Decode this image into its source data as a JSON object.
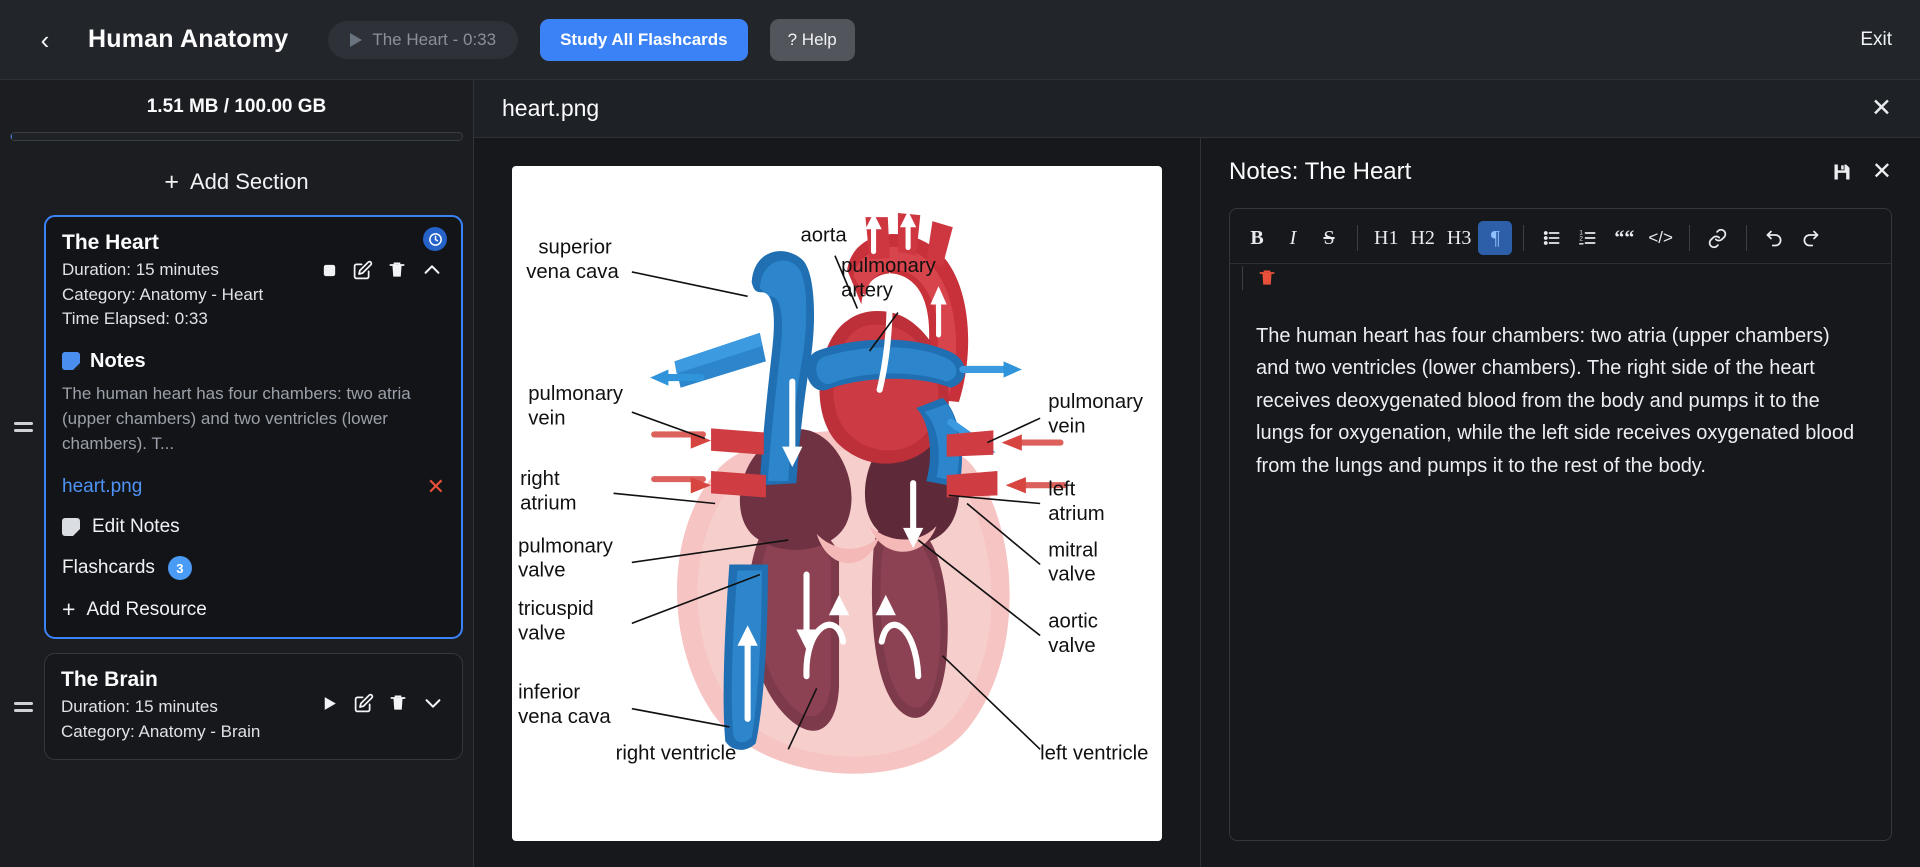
{
  "topbar": {
    "back_icon": "chevron-left-icon",
    "app_title": "Human Anatomy",
    "timer_label": "The Heart - 0:33",
    "study_all_label": "Study All Flashcards",
    "help_label": "? Help",
    "exit_label": "Exit",
    "accent": "#3b82f6"
  },
  "sidebar": {
    "storage_label": "1.51 MB / 100.00 GB",
    "add_section_label": "Add Section",
    "sections": [
      {
        "title": "The Heart",
        "duration": "Duration: 15 minutes",
        "category": "Category: Anatomy - Heart",
        "time_elapsed": "Time Elapsed: 0:33",
        "active": true,
        "notes_heading": "Notes",
        "notes_excerpt": "The human heart has four chambers: two atria (upper chambers) and two ventricles (lower chambers). T...",
        "resource_name": "heart.png",
        "edit_notes_label": "Edit Notes",
        "flashcards_label": "Flashcards",
        "flashcards_count": "3",
        "add_resource_label": "Add Resource"
      },
      {
        "title": "The Brain",
        "duration": "Duration: 15 minutes",
        "category": "Category: Anatomy - Brain",
        "active": false
      }
    ]
  },
  "main": {
    "file_name": "heart.png",
    "close_icon": "close-icon"
  },
  "notes_panel": {
    "title": "Notes: The Heart",
    "save_icon": "save-icon",
    "close_icon": "close-icon",
    "toolbar": {
      "bold": "B",
      "italic": "I",
      "strike": "S",
      "h1": "H1",
      "h2": "H2",
      "h3": "H3",
      "paragraph": "¶",
      "bullet_list": "bullet-list-icon",
      "numbered_list": "numbered-list-icon",
      "blockquote": "quote-icon",
      "code_block": "code-icon",
      "link": "link-icon",
      "undo": "undo-icon",
      "redo": "redo-icon",
      "delete": "trash-icon"
    },
    "content": "The human heart has four chambers: two atria (upper chambers) and two ventricles (lower chambers). The right side of the heart receives deoxygenated blood from the body and pumps it to the lungs for oxygenation, while the left side receives oxygenated blood from the lungs and pumps it to the rest of the body."
  },
  "diagram": {
    "labels": {
      "superior_vena_cava": "superior\nvena cava",
      "superior_vena_cava_l1": "superior",
      "superior_vena_cava_l2": "vena cava",
      "aorta": "aorta",
      "pulmonary_artery_l1": "pulmonary",
      "pulmonary_artery_l2": "artery",
      "pulmonary_vein_left_l1": "pulmonary",
      "pulmonary_vein_left_l2": "vein",
      "pulmonary_vein_right_l1": "pulmonary",
      "pulmonary_vein_right_l2": "vein",
      "right_atrium_l1": "right",
      "right_atrium_l2": "atrium",
      "left_atrium_l1": "left",
      "left_atrium_l2": "atrium",
      "pulmonary_valve_l1": "pulmonary",
      "pulmonary_valve_l2": "valve",
      "mitral_valve_l1": "mitral",
      "mitral_valve_l2": "valve",
      "tricuspid_valve_l1": "tricuspid",
      "tricuspid_valve_l2": "valve",
      "aortic_valve_l1": "aortic",
      "aortic_valve_l2": "valve",
      "inferior_vena_cava_l1": "inferior",
      "inferior_vena_cava_l2": "vena cava",
      "right_ventricle": "right ventricle",
      "left_ventricle": "left ventricle"
    }
  }
}
